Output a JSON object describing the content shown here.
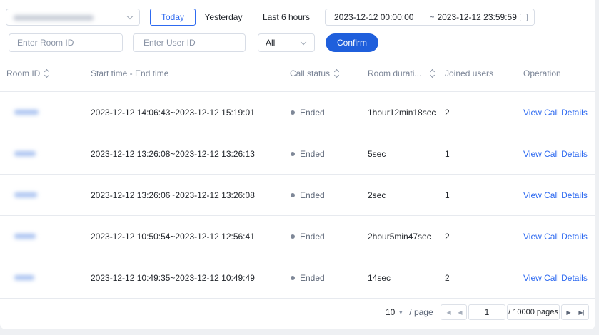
{
  "filters": {
    "app_select_value": "",
    "tabs": [
      {
        "label": "Today",
        "active": true
      },
      {
        "label": "Yesterday",
        "active": false
      },
      {
        "label": "Last 6 hours",
        "active": false
      }
    ],
    "date_start": "2023-12-12 00:00:00",
    "date_separator": "~",
    "date_end": "2023-12-12 23:59:59",
    "room_id_placeholder": "Enter Room ID",
    "user_id_placeholder": "Enter User ID",
    "status_select_value": "All",
    "confirm_label": "Confirm"
  },
  "table": {
    "headers": {
      "room_id": "Room ID",
      "time": "Start time - End time",
      "status": "Call status",
      "duration": "Room durati...",
      "users": "Joined users",
      "operation": "Operation"
    },
    "rows": [
      {
        "time": "2023-12-12 14:06:43~2023-12-12 15:19:01",
        "status": "Ended",
        "duration": "1hour12min18sec",
        "users": "2",
        "action": "View Call Details"
      },
      {
        "time": "2023-12-12 13:26:08~2023-12-12 13:26:13",
        "status": "Ended",
        "duration": "5sec",
        "users": "1",
        "action": "View Call Details"
      },
      {
        "time": "2023-12-12 13:26:06~2023-12-12 13:26:08",
        "status": "Ended",
        "duration": "2sec",
        "users": "1",
        "action": "View Call Details"
      },
      {
        "time": "2023-12-12 10:50:54~2023-12-12 12:56:41",
        "status": "Ended",
        "duration": "2hour5min47sec",
        "users": "2",
        "action": "View Call Details"
      },
      {
        "time": "2023-12-12 10:49:35~2023-12-12 10:49:49",
        "status": "Ended",
        "duration": "14sec",
        "users": "2",
        "action": "View Call Details"
      }
    ]
  },
  "pagination": {
    "page_size": "10",
    "page_size_suffix": "/ page",
    "current_page": "1",
    "total_pages": "/ 10000 pages"
  },
  "colors": {
    "accent": "#2e6af0",
    "confirm_bg": "#1f5fdc",
    "status_dot": "#7f8898"
  },
  "icons": {
    "calendar": "calendar-icon",
    "sort": "sort-icon",
    "chevron": "chevron-down-icon"
  }
}
